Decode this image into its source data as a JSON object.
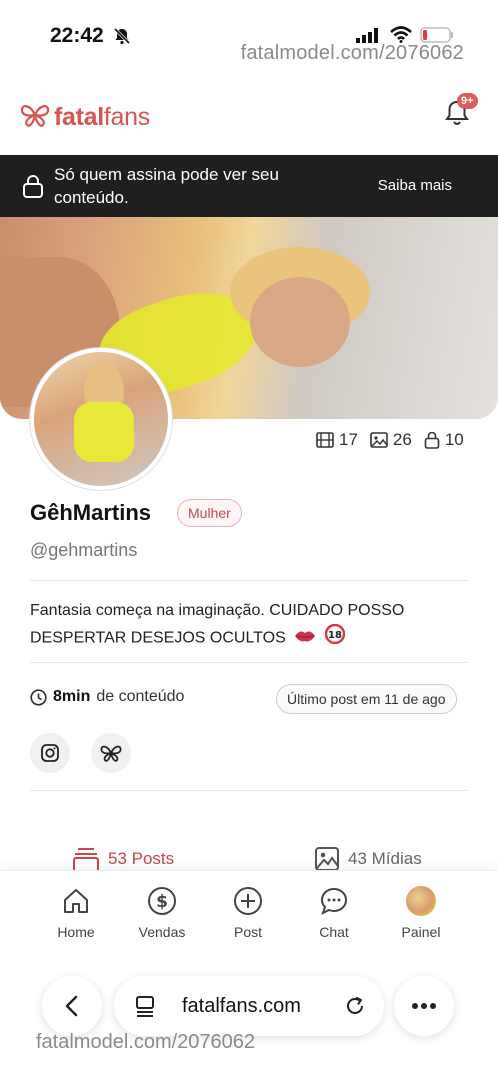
{
  "status_bar": {
    "time": "22:42"
  },
  "watermarks": {
    "top": "fatalmodel.com/2076062",
    "bottom": "fatalmodel.com/2076062"
  },
  "header": {
    "logo_text_bold": "fatal",
    "logo_text": "fans",
    "notification_badge": "9+",
    "brand_color": "#d9534f"
  },
  "banner": {
    "message": "Só quem assina pode ver seu conteúdo.",
    "action": "Saiba mais"
  },
  "profile": {
    "counts": {
      "videos": "17",
      "photos": "26",
      "locked": "10"
    },
    "name": "GêhMartins",
    "gender": "Mulher",
    "handle": "@gehmartins",
    "bio": "Fantasia começa na imaginação. CUIDADO POSSO DESPERTAR DESEJOS OCULTOS",
    "content_duration": "8min",
    "content_suffix": "de conteúdo",
    "last_post": "Último post em 11 de ago"
  },
  "tabs": {
    "posts": "53 Posts",
    "media": "43 Mídias"
  },
  "bottom_nav": [
    "Home",
    "Vendas",
    "Post",
    "Chat",
    "Painel"
  ],
  "browser": {
    "url": "fatalfans.com"
  }
}
